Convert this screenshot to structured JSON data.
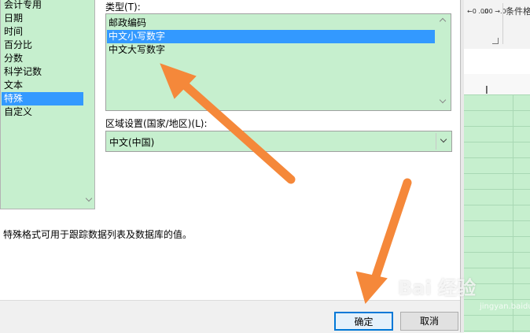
{
  "categories": {
    "items": [
      "会计专用",
      "日期",
      "时间",
      "百分比",
      "分数",
      "科学记数",
      "文本",
      "特殊",
      "自定义"
    ],
    "selected_index": 7
  },
  "type_section": {
    "label": "类型(T):",
    "items": [
      "邮政编码",
      "中文小写数字",
      "中文大写数字"
    ],
    "selected_index": 1
  },
  "locale_section": {
    "label": "区域设置(国家/地区)(L):",
    "value": "中文(中国)"
  },
  "description": "特殊格式可用于跟踪数据列表及数据库的值。",
  "buttons": {
    "ok": "确定",
    "cancel": "取消"
  },
  "ribbon": {
    "increase_decimal": "←0 .00",
    "decrease_decimal": ".00 →.0",
    "conditional_format": "条件格"
  },
  "watermark": {
    "text": "Bai 经验",
    "sub": "jingyan.baidu.com"
  },
  "colors": {
    "list_background": "#c6efce",
    "selection": "#3399ff",
    "arrow": "#f5883a",
    "default_button_border": "#0078d7"
  }
}
